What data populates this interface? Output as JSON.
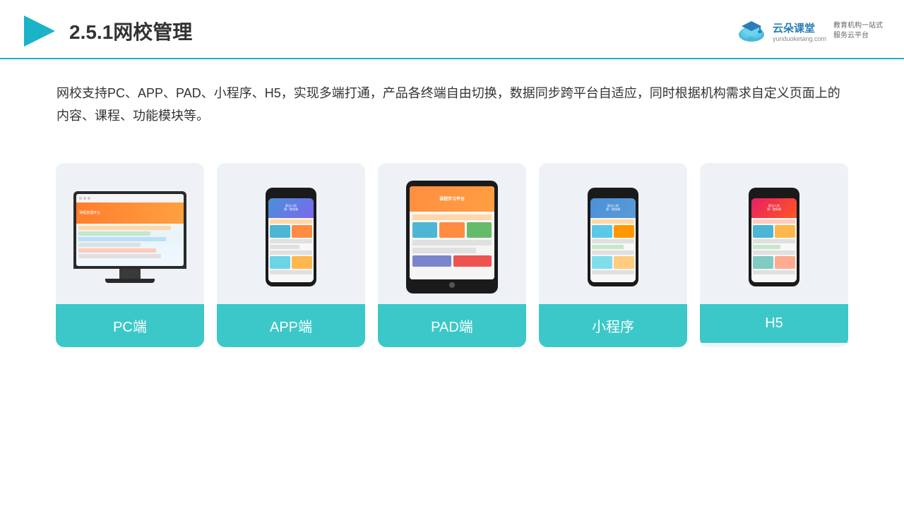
{
  "header": {
    "title": "2.5.1网校管理",
    "logo": {
      "brand": "云朵课堂",
      "url": "yunduoketang.com",
      "tagline": "教育机构一站式服务云平台"
    }
  },
  "description": {
    "text": "网校支持PC、APP、PAD、小程序、H5，实现多端打通，产品各终端自由切换，数据同步跨平台自适应，同时根据机构需求自定义页面上的内容、课程、功能模块等。"
  },
  "cards": [
    {
      "id": "pc",
      "label": "PC端",
      "type": "monitor"
    },
    {
      "id": "app",
      "label": "APP端",
      "type": "phone"
    },
    {
      "id": "pad",
      "label": "PAD端",
      "type": "tablet"
    },
    {
      "id": "miniprogram",
      "label": "小程序",
      "type": "phone"
    },
    {
      "id": "h5",
      "label": "H5",
      "type": "phone"
    }
  ],
  "colors": {
    "accent": "#3cc8c8",
    "header_line": "#1ab3c8",
    "bg_card": "#eef2f7",
    "title": "#333333"
  }
}
